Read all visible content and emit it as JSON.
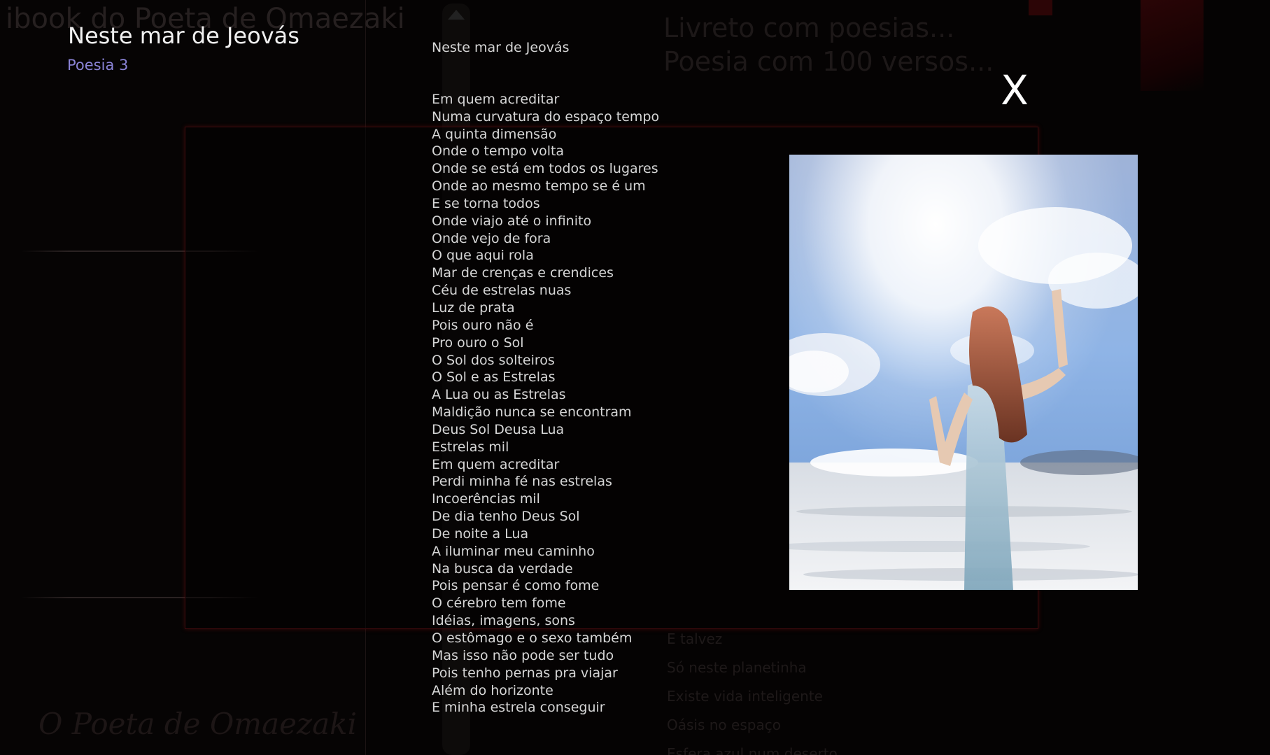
{
  "background": {
    "app_title": "ibook do Poeta de Omaezaki",
    "book_heading": [
      "Livreto com poesias...",
      "Poesia com 100 versos..."
    ],
    "signature": "O Poeta de Omaezaki",
    "list_items": [
      "E talvez",
      "Só neste planetinha",
      "Existe vida inteligente",
      "Oásis no espaço",
      "Esfera azul num deserto"
    ]
  },
  "header": {
    "title": "Neste mar de Jeovás",
    "subtitle": "Poesia 3"
  },
  "close": {
    "label": "X"
  },
  "poem": {
    "heading": "Neste mar de Jeovás",
    "lines": [
      "Em quem acreditar",
      "Numa curvatura do espaço tempo",
      "A quinta dimensão",
      "Onde o tempo volta",
      "Onde se está em todos os lugares",
      "Onde ao mesmo tempo se é um",
      "E se torna todos",
      "Onde viajo até o infinito",
      "Onde vejo de fora",
      "O que aqui rola",
      "Mar de crenças e crendices",
      "Céu de estrelas nuas",
      "Luz de prata",
      "Pois ouro não é",
      "Pro ouro o Sol",
      "O Sol dos solteiros",
      "O Sol e as Estrelas",
      "A Lua ou as Estrelas",
      "Maldição nunca se encontram",
      "Deus Sol Deusa Lua",
      "Estrelas mil",
      "Em quem acreditar",
      "Perdi minha fé nas estrelas",
      "Incoerências mil",
      "De dia tenho Deus Sol",
      "De noite a Lua",
      "A iluminar meu caminho",
      "Na busca da verdade",
      "Pois pensar é como fome",
      "O cérebro tem fome",
      "Idéias, imagens, sons",
      "O estômago e o sexo também",
      "Mas isso não pode ser tudo",
      "Pois tenho pernas pra viajar",
      "Além do horizonte",
      "E minha estrela conseguir"
    ]
  }
}
